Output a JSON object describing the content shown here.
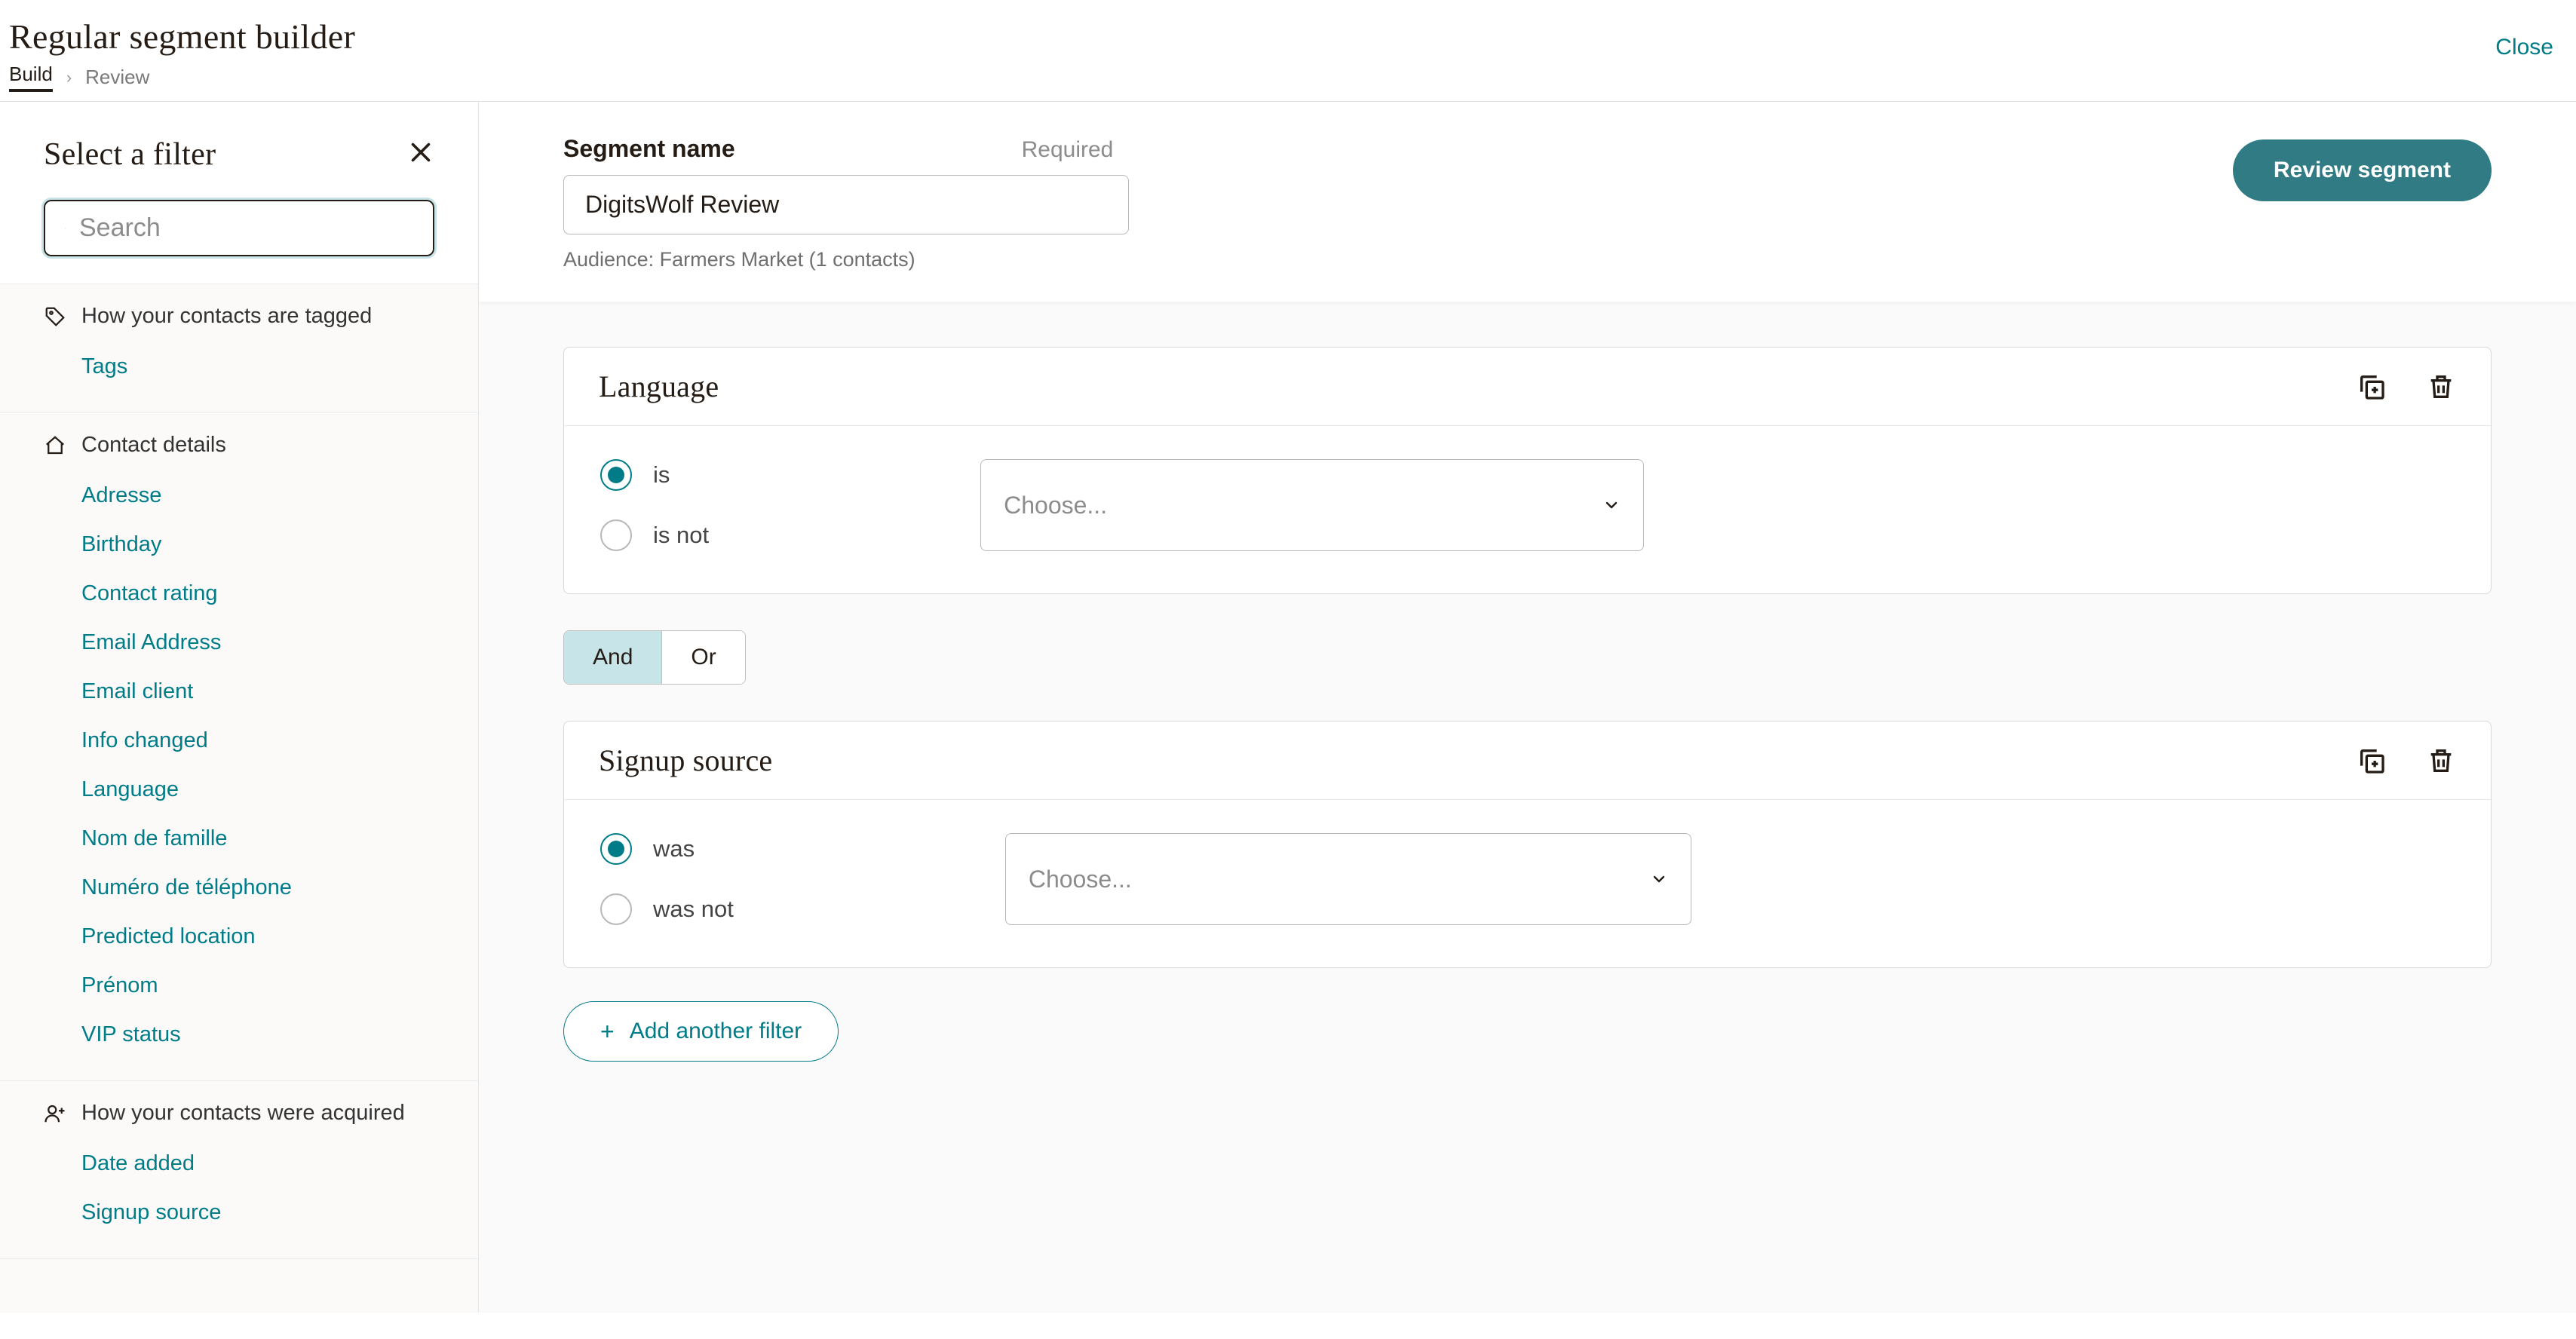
{
  "header": {
    "title": "Regular segment builder",
    "breadcrumb": {
      "build": "Build",
      "review": "Review"
    },
    "close": "Close"
  },
  "sidebar": {
    "title": "Select a filter",
    "search_placeholder": "Search",
    "groups": [
      {
        "label": "How your contacts are tagged",
        "items": [
          "Tags"
        ]
      },
      {
        "label": "Contact details",
        "items": [
          "Adresse",
          "Birthday",
          "Contact rating",
          "Email Address",
          "Email client",
          "Info changed",
          "Language",
          "Nom de famille",
          "Numéro de téléphone",
          "Predicted location",
          "Prénom",
          "VIP status"
        ]
      },
      {
        "label": "How your contacts were acquired",
        "items": [
          "Date added",
          "Signup source"
        ]
      }
    ]
  },
  "segname": {
    "label": "Segment name",
    "required": "Required",
    "value": "DigitsWolf Review",
    "audience": "Audience: Farmers Market (1 contacts)",
    "review_btn": "Review segment"
  },
  "filters": [
    {
      "title": "Language",
      "radios": [
        {
          "label": "is",
          "checked": true
        },
        {
          "label": "is not",
          "checked": false
        }
      ],
      "dropdown_placeholder": "Choose...",
      "dropdown_width": "w880"
    },
    {
      "title": "Signup source",
      "radios": [
        {
          "label": "was",
          "checked": true
        },
        {
          "label": "was not",
          "checked": false
        }
      ],
      "dropdown_placeholder": "Choose...",
      "dropdown_width": "w910"
    }
  ],
  "connector": {
    "and": "And",
    "or": "Or",
    "active": "and"
  },
  "add_filter": "Add another filter"
}
